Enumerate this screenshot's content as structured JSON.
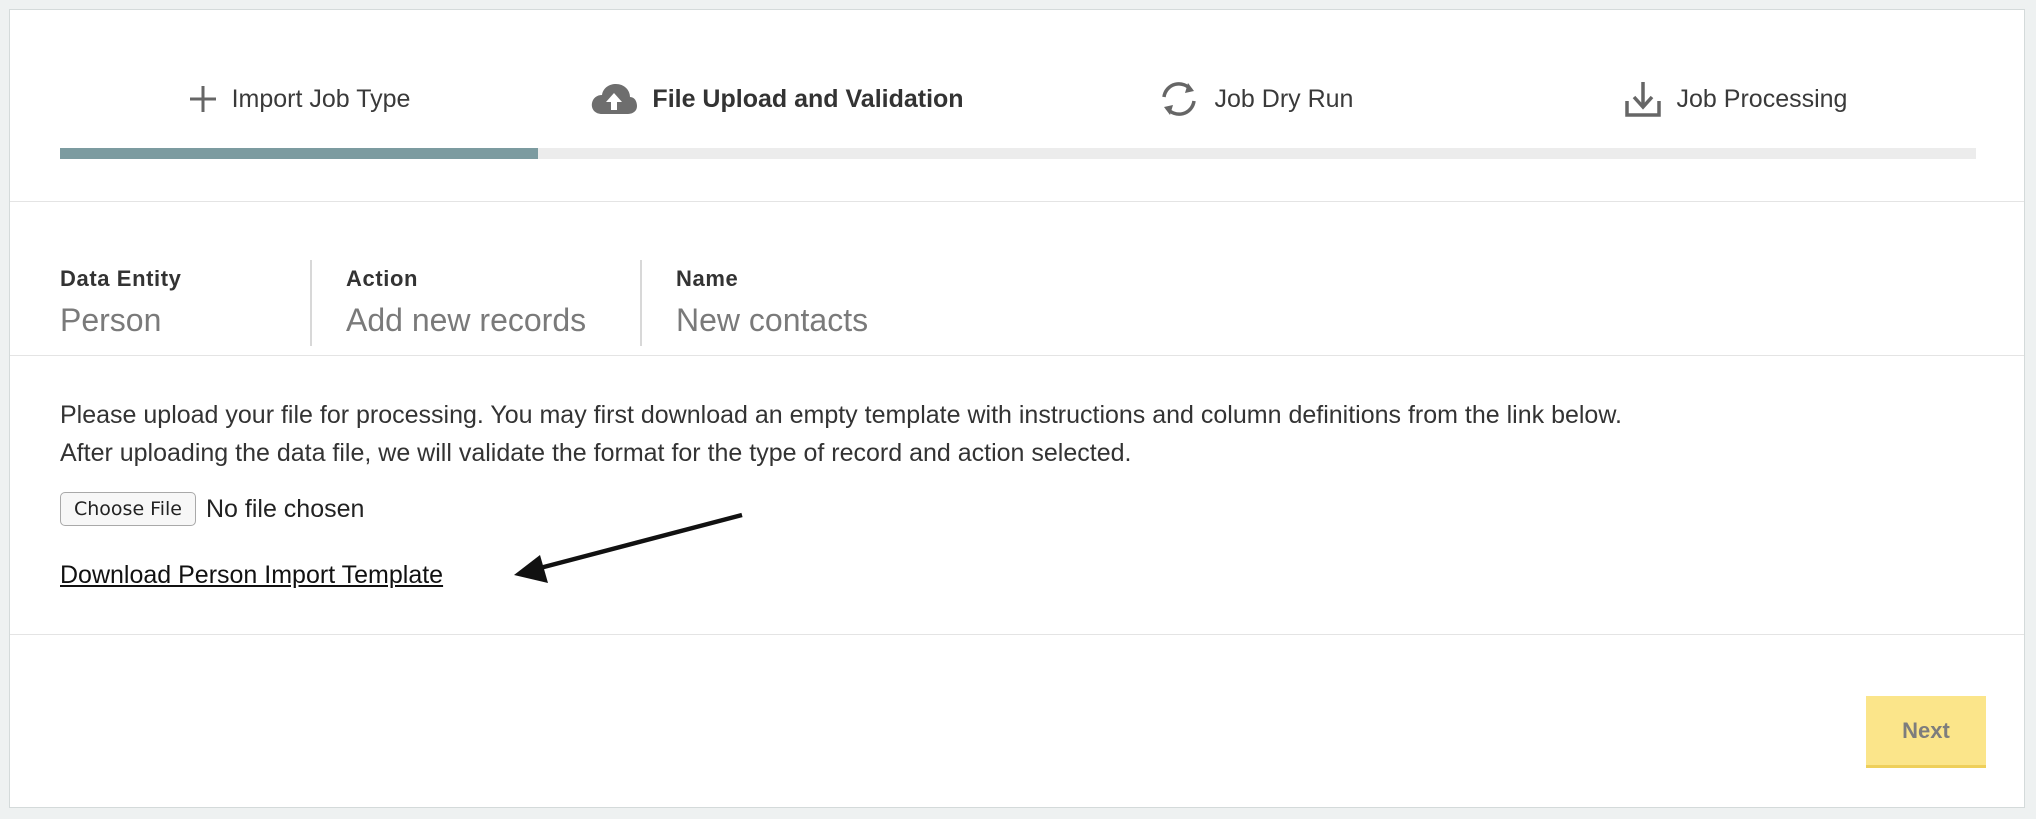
{
  "steps": [
    {
      "label": "Import Job Type",
      "icon": "plus-icon"
    },
    {
      "label": "File Upload and Validation",
      "icon": "cloud-upload-icon"
    },
    {
      "label": "Job Dry Run",
      "icon": "refresh-icon"
    },
    {
      "label": "Job Processing",
      "icon": "download-icon"
    }
  ],
  "active_step_index": 1,
  "summary": {
    "data_entity": {
      "label": "Data Entity",
      "value": "Person"
    },
    "action": {
      "label": "Action",
      "value": "Add new records"
    },
    "name": {
      "label": "Name",
      "value": "New contacts"
    }
  },
  "instructions": {
    "line1": "Please upload your file for processing. You may first download an empty template with instructions and column definitions from the link below.",
    "line2": "After uploading the data file, we will validate the format for the type of record and action selected."
  },
  "file_input": {
    "button_label": "Choose File",
    "status": "No file chosen"
  },
  "template_link": "Download Person Import Template",
  "next_button": "Next",
  "colors": {
    "progress_fill": "#7c9ba0",
    "next_button_bg": "#fbe58a"
  }
}
